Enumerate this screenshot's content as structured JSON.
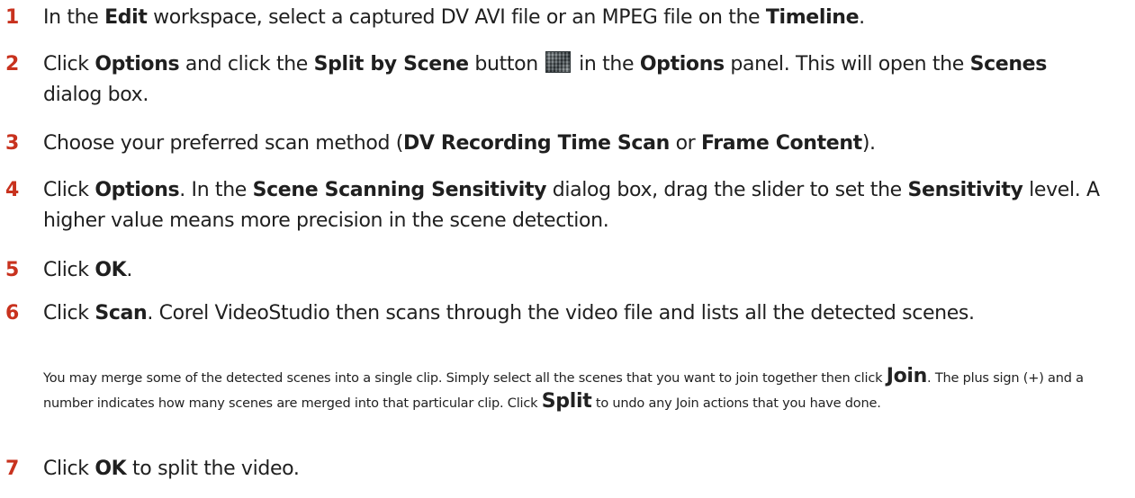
{
  "steps": [
    {
      "num": "1",
      "parts": [
        {
          "t": "In the "
        },
        {
          "t": "Edit",
          "b": true
        },
        {
          "t": " workspace, select a captured DV AVI file or an MPEG file on the "
        },
        {
          "t": "Timeline",
          "b": true
        },
        {
          "t": "."
        }
      ]
    },
    {
      "num": "2",
      "parts": [
        {
          "t": "Click "
        },
        {
          "t": "Options",
          "b": true
        },
        {
          "t": " and click the "
        },
        {
          "t": "Split by Scene",
          "b": true
        },
        {
          "t": " button "
        },
        {
          "icon": "split-by-scene-icon"
        },
        {
          "t": " in the "
        },
        {
          "t": "Options",
          "b": true
        },
        {
          "t": " panel. This will open the "
        },
        {
          "t": "Scenes",
          "b": true
        },
        {
          "t": " dialog box."
        }
      ]
    },
    {
      "num": "3",
      "parts": [
        {
          "t": "Choose your preferred scan method ("
        },
        {
          "t": "DV Recording Time Scan",
          "b": true
        },
        {
          "t": " or "
        },
        {
          "t": "Frame Content",
          "b": true
        },
        {
          "t": ")."
        }
      ]
    },
    {
      "num": "4",
      "parts": [
        {
          "t": "Click "
        },
        {
          "t": "Options",
          "b": true
        },
        {
          "t": ". In the "
        },
        {
          "t": "Scene Scanning Sensitivity",
          "b": true
        },
        {
          "t": " dialog box, drag the slider to set the "
        },
        {
          "t": "Sensitivity",
          "b": true
        },
        {
          "t": " level. A higher value means more precision in the scene detection."
        }
      ]
    },
    {
      "num": "5",
      "parts": [
        {
          "t": "Click "
        },
        {
          "t": "OK",
          "b": true
        },
        {
          "t": "."
        }
      ]
    },
    {
      "num": "6",
      "parts": [
        {
          "t": "Click "
        },
        {
          "t": "Scan",
          "b": true
        },
        {
          "t": ". Corel VideoStudio then scans through the video file and lists all the detected scenes."
        }
      ]
    },
    {
      "num": "7",
      "parts": [
        {
          "t": "Click "
        },
        {
          "t": "OK",
          "b": true
        },
        {
          "t": " to split the video."
        }
      ]
    }
  ],
  "note": {
    "parts": [
      {
        "t": "You may merge some of the detected scenes into a single clip. Simply select all the scenes that you want to join together then click "
      },
      {
        "t": "Join",
        "b": true
      },
      {
        "t": ". The plus sign (+) and a number indicates how many scenes are merged into that particular clip. Click "
      },
      {
        "t": "Split",
        "b": true
      },
      {
        "t": " to undo any Join actions that you have done."
      }
    ]
  }
}
